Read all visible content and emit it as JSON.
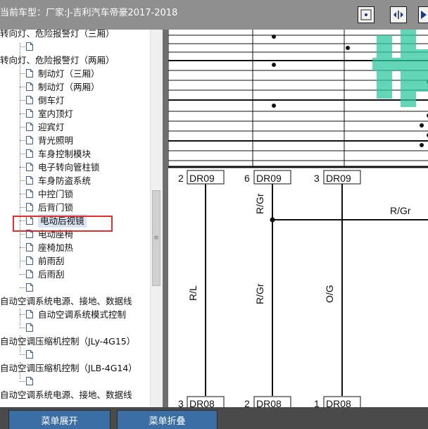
{
  "header": {
    "title": "当前车型：厂家:J-吉利汽车帝豪2017-2018"
  },
  "tree": {
    "items": [
      {
        "label": "转向灯、危险报警灯（三厢）"
      },
      {
        "label": ""
      },
      {
        "label": "转向灯、危险报警灯（两厢）"
      },
      {
        "label": "制动灯（三厢）"
      },
      {
        "label": "制动灯（两厢）"
      },
      {
        "label": "倒车灯"
      },
      {
        "label": "室内顶灯"
      },
      {
        "label": "迎宾灯"
      },
      {
        "label": "背光照明"
      },
      {
        "label": "车身控制模块"
      },
      {
        "label": "电子转向管柱锁"
      },
      {
        "label": "车身防盗系统"
      },
      {
        "label": "中控门锁"
      },
      {
        "label": "后背门锁"
      },
      {
        "label": "电动后视镜"
      },
      {
        "label": "电动座椅"
      },
      {
        "label": "座椅加热"
      },
      {
        "label": "前雨刮"
      },
      {
        "label": "后雨刮"
      },
      {
        "label": ""
      },
      {
        "label": "自动空调系统电源、接地、数据线"
      },
      {
        "label": "自动空调系统模式控制"
      },
      {
        "label": ""
      },
      {
        "label": "自动空调压缩机控制（JLy-4G15）"
      },
      {
        "label": ""
      },
      {
        "label": "自动空调压缩机控制（JLB-4G14）"
      },
      {
        "label": ""
      },
      {
        "label": "自动空调系统电源、接地、数据线"
      }
    ]
  },
  "diagram": {
    "connectors": [
      {
        "pin": "2",
        "code": "DR09"
      },
      {
        "pin": "6",
        "code": "DR09"
      },
      {
        "pin": "3",
        "code": "DR09"
      }
    ],
    "bottom_connectors": [
      {
        "pin": "3",
        "code": "DR08"
      },
      {
        "pin": "2",
        "code": "DR08"
      },
      {
        "pin": "1",
        "code": "DR08"
      }
    ],
    "wires": [
      "R/L",
      "R/Gr",
      "O/G"
    ],
    "top_wire_label": "R/Gr",
    "branch_label": "R/Gr",
    "accent_color": "#2ec9a0"
  },
  "bottom": {
    "expand_label": "菜单展开",
    "collapse_label": "菜单折叠"
  }
}
